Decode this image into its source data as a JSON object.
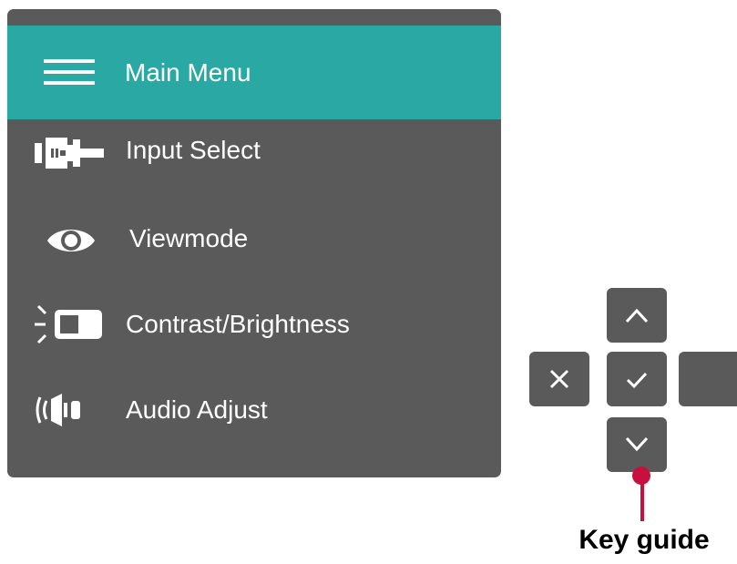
{
  "menu": {
    "header": {
      "label": "Main Menu",
      "icon": "hamburger-icon"
    },
    "items": [
      {
        "label": "Input Select",
        "icon": "input-connector-icon"
      },
      {
        "label": "Viewmode",
        "icon": "eye-icon"
      },
      {
        "label": "Contrast/Brightness",
        "icon": "brightness-icon"
      },
      {
        "label": "Audio Adjust",
        "icon": "speaker-icon"
      }
    ]
  },
  "keypad": {
    "keys": [
      {
        "icon": "chevron-up-icon"
      },
      {
        "icon": "close-icon"
      },
      {
        "icon": "check-icon"
      },
      {
        "icon": "blank-key"
      },
      {
        "icon": "chevron-down-icon"
      }
    ]
  },
  "key_guide": {
    "label": "Key guide"
  },
  "colors": {
    "panel": "#5b5a5b",
    "header": "#2aa8a3",
    "text": "#ffffff",
    "pointer": "#c8103e"
  }
}
